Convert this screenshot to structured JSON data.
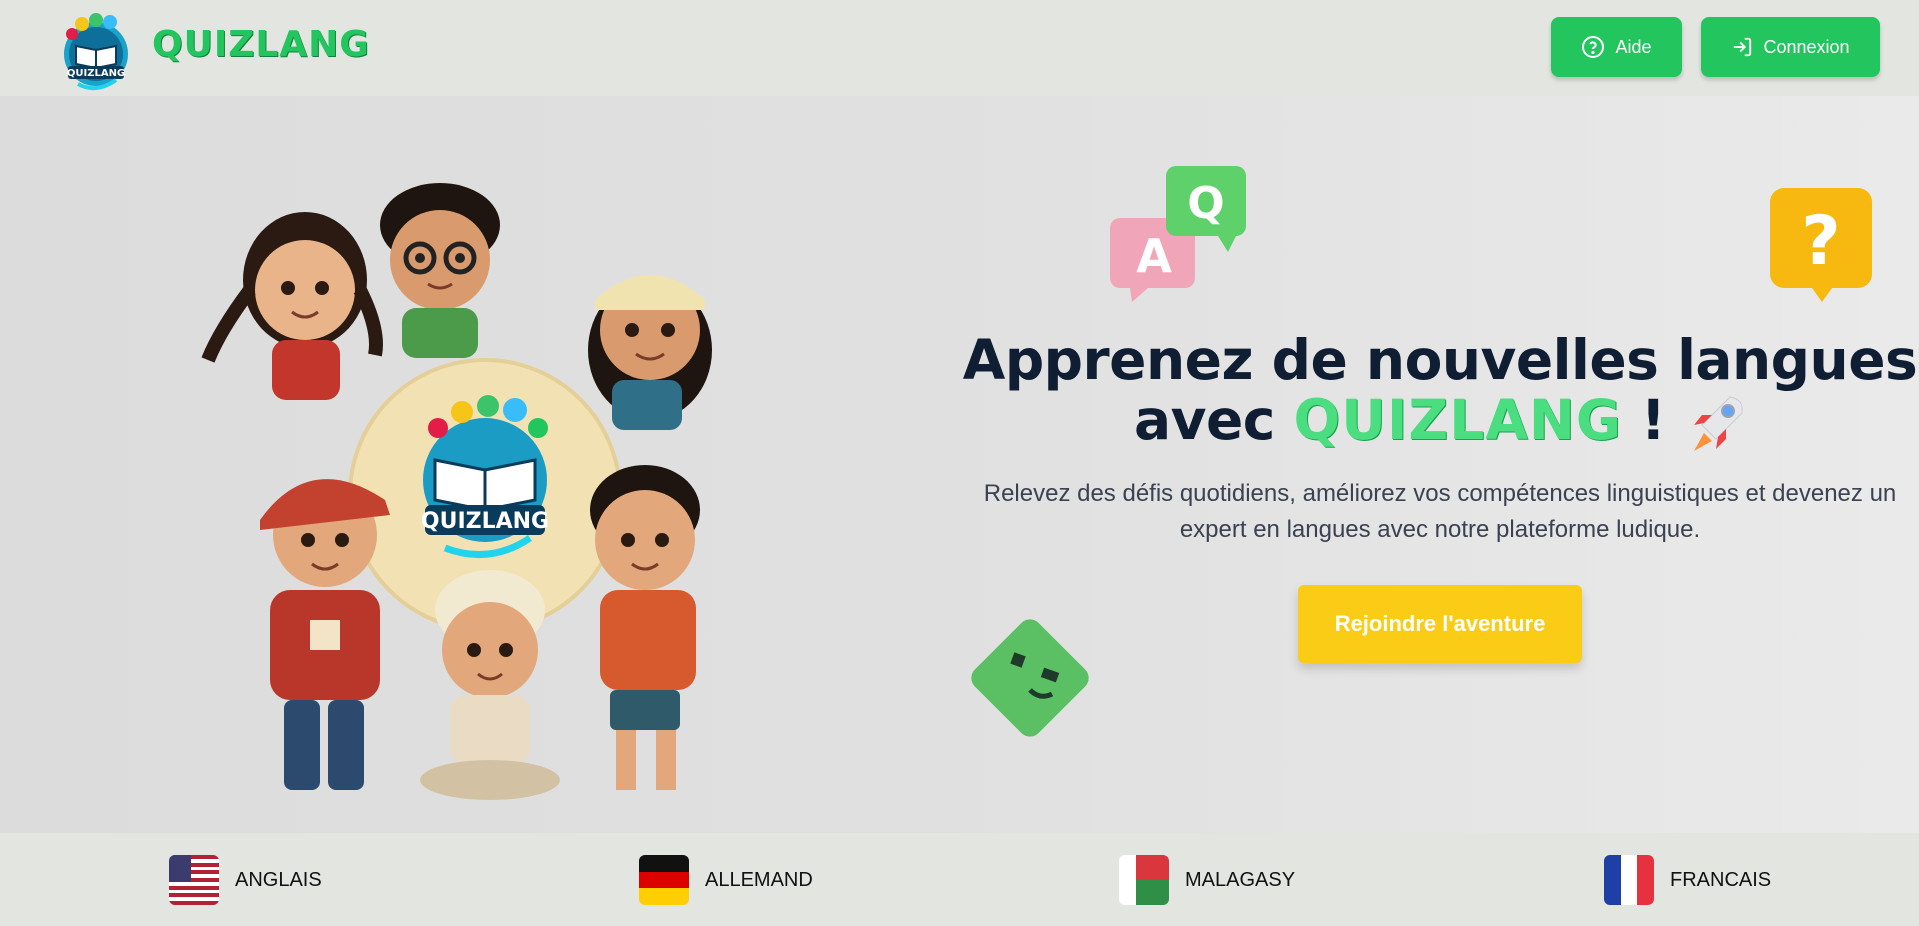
{
  "header": {
    "brand": "QUIZLANG",
    "logo_text": "QUIZLANG",
    "help_label": "Aide",
    "login_label": "Connexion"
  },
  "hero": {
    "headline_line1": "Apprenez de nouvelles langues",
    "headline_avec": "avec",
    "headline_brand": "QUIZLANG",
    "headline_end": "!",
    "subtitle_line1": "Relevez des défis quotidiens, améliorez vos compétences linguistiques et devenez un",
    "subtitle_line2": "expert en langues avec notre plateforme ludique.",
    "cta_label": "Rejoindre l'aventure",
    "center_logo_text": "QUIZLANG",
    "deco_a": "A",
    "deco_q": "Q",
    "deco_question": "?"
  },
  "languages": [
    {
      "label": "ANGLAIS",
      "flag": "us-flag-icon"
    },
    {
      "label": "ALLEMAND",
      "flag": "de-flag-icon"
    },
    {
      "label": "MALAGASY",
      "flag": "mg-flag-icon"
    },
    {
      "label": "FRANCAIS",
      "flag": "fr-flag-icon"
    }
  ],
  "colors": {
    "primary_green": "#22c55e",
    "accent_yellow": "#facc15",
    "heading_navy": "#0f1e33",
    "header_bg": "#e2e5e0"
  }
}
